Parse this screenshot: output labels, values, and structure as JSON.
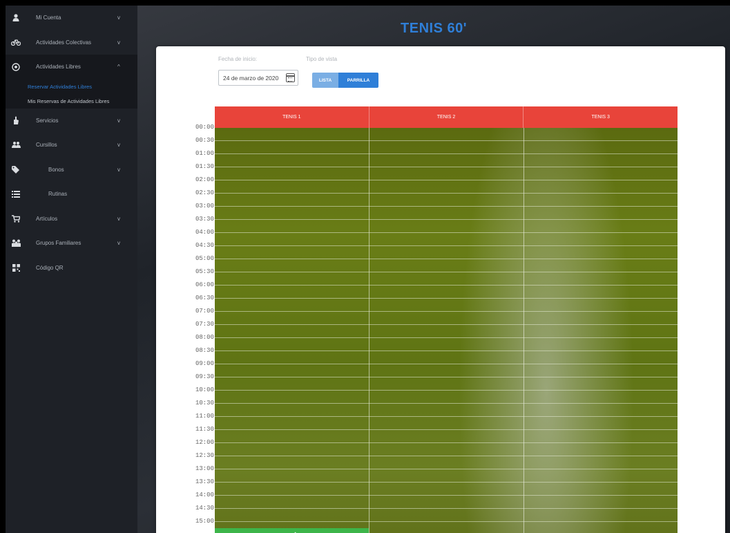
{
  "sidebar": {
    "items": [
      {
        "label": "Mi Cuenta",
        "icon": "user-icon",
        "chevron": "v"
      },
      {
        "label": "Actividades Colectivas",
        "icon": "bicycle-icon",
        "chevron": "v"
      },
      {
        "label": "Actividades Libres",
        "icon": "soccer-ball-icon",
        "chevron": "^"
      },
      {
        "label": "Servicios",
        "icon": "hand-icon",
        "chevron": "v"
      },
      {
        "label": "Cursillos",
        "icon": "group-icon",
        "chevron": "v"
      },
      {
        "label": "Bonos",
        "icon": "tags-icon",
        "chevron": "v"
      },
      {
        "label": "Rutinas",
        "icon": "list-icon",
        "chevron": ""
      },
      {
        "label": "Artículos",
        "icon": "cart-icon",
        "chevron": "v"
      },
      {
        "label": "Grupos Familiares",
        "icon": "family-icon",
        "chevron": "v"
      },
      {
        "label": "Código QR",
        "icon": "qr-code-icon",
        "chevron": ""
      }
    ],
    "subitems": [
      {
        "label": "Reservar Actividades Libres",
        "current": true
      },
      {
        "label": "Mis Reservas de Actividades Libres",
        "current": false
      }
    ]
  },
  "header": {
    "title": "TENIS 60'"
  },
  "filters": {
    "start_date_label": "Fecha de inicio:",
    "start_date_value": "24 de marzo de 2020",
    "view_type_label": "Tipo de vista",
    "view_list": "LISTA",
    "view_grid": "PARRILLA",
    "selected_view": "PARRILLA"
  },
  "schedule": {
    "courts": [
      "TENIS 1",
      "TENIS 2",
      "TENIS 3"
    ],
    "times": [
      "00:00",
      "00:30",
      "01:00",
      "01:30",
      "02:00",
      "02:30",
      "03:00",
      "03:30",
      "04:00",
      "04:30",
      "05:00",
      "05:30",
      "06:00",
      "06:30",
      "07:00",
      "07:30",
      "08:00",
      "08:30",
      "09:00",
      "09:30",
      "10:00",
      "10:30",
      "11:00",
      "11:30",
      "12:00",
      "12:30",
      "13:00",
      "13:30",
      "14:00",
      "14:30",
      "15:00"
    ]
  },
  "colors": {
    "accent": "#2f7fd8",
    "court_header": "#e8443a",
    "available_slot": "#3db54a",
    "sidebar_bg": "#1e2127"
  }
}
